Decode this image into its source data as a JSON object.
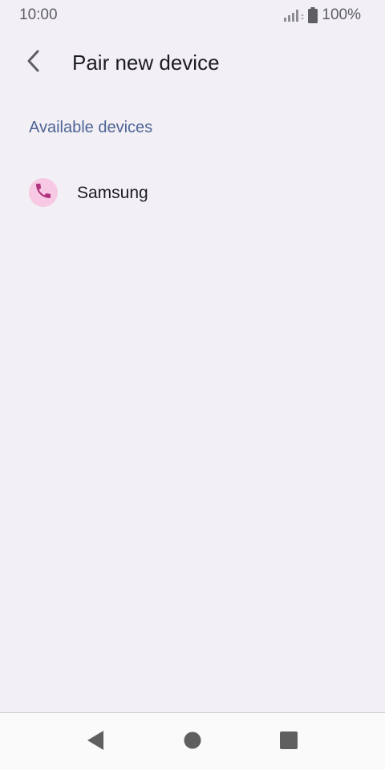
{
  "status_bar": {
    "time": "10:00",
    "battery_percent": "100%",
    "signal_icon": "signal-icon",
    "battery_icon": "battery-icon"
  },
  "app_bar": {
    "back_icon": "back-arrow-icon",
    "title": "Pair new device"
  },
  "available_devices": {
    "header": "Available devices",
    "items": [
      {
        "name": "Samsung",
        "icon": "phone-icon"
      }
    ]
  },
  "nav_bar": {
    "back_icon": "nav-back-icon",
    "home_icon": "nav-home-icon",
    "recents_icon": "nav-recents-icon"
  },
  "colors": {
    "background": "#f2f0f4",
    "section_header": "#4f6497",
    "device_icon_bg": "#f7c9e4",
    "device_icon_fg": "#b0357e"
  }
}
